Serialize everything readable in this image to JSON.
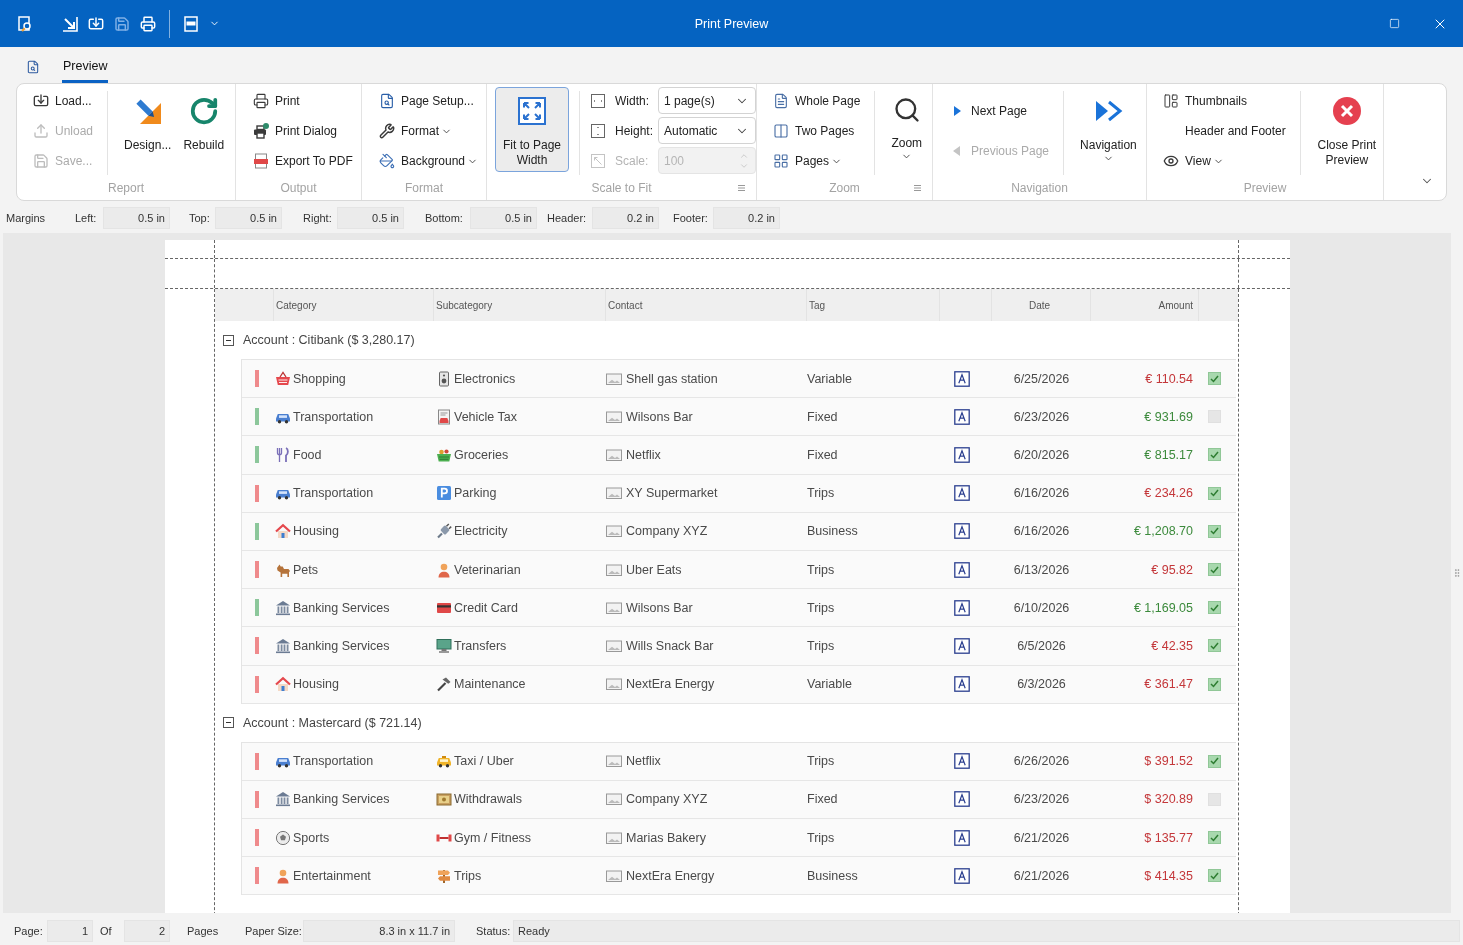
{
  "window": {
    "title": "Print Preview"
  },
  "quick_access": [
    {
      "disabled": false
    },
    {
      "disabled": false
    },
    {
      "disabled": true
    },
    {
      "disabled": false
    },
    {
      "disabled": false
    }
  ],
  "ribbon": {
    "tabs": [
      {
        "label": "Preview",
        "selected": true
      }
    ],
    "groups": [
      {
        "label": "Report",
        "columns": [
          {
            "kind": "stack",
            "items": [
              {
                "label": "Load...",
                "disabled": false
              },
              {
                "label": "Unload",
                "disabled": true
              },
              {
                "label": "Save...",
                "disabled": true
              }
            ]
          },
          {
            "kind": "large",
            "items": [
              {
                "label": "Design..."
              },
              {
                "label": "Rebuild"
              }
            ]
          }
        ]
      },
      {
        "label": "Output",
        "columns": [
          {
            "kind": "stack",
            "items": [
              {
                "label": "Print"
              },
              {
                "label": "Print Dialog"
              },
              {
                "label": "Export To PDF"
              }
            ]
          }
        ]
      },
      {
        "label": "Format",
        "columns": [
          {
            "kind": "stack",
            "items": [
              {
                "label": "Page Setup..."
              },
              {
                "label": "Format",
                "dropdown": true
              },
              {
                "label": "Background",
                "dropdown": true
              }
            ]
          }
        ]
      },
      {
        "label": "Scale to Fit",
        "launcher": true,
        "columns": [
          {
            "kind": "large",
            "items": [
              {
                "label": "Fit to Page Width",
                "selected": true
              }
            ]
          },
          {
            "kind": "fields",
            "items": [
              {
                "label": "Width:",
                "value": "1 page(s)",
                "kind": "dropdown",
                "disabled": false
              },
              {
                "label": "Height:",
                "value": "Automatic",
                "kind": "dropdown",
                "disabled": false
              },
              {
                "label": "Scale:",
                "value": "100",
                "kind": "spinner",
                "disabled": true
              }
            ]
          }
        ]
      },
      {
        "label": "Zoom",
        "launcher": true,
        "columns": [
          {
            "kind": "stack",
            "items": [
              {
                "label": "Whole Page"
              },
              {
                "label": "Two Pages"
              },
              {
                "label": "Pages",
                "dropdown": true
              }
            ]
          },
          {
            "kind": "large",
            "items": [
              {
                "label": "Zoom",
                "dropdown": true
              }
            ]
          }
        ]
      },
      {
        "label": "Navigation",
        "columns": [
          {
            "kind": "stack",
            "items": [
              {
                "label": "Next Page",
                "disabled": false
              },
              {
                "label": "Previous Page",
                "disabled": true
              }
            ]
          },
          {
            "kind": "large",
            "items": [
              {
                "label": "Navigation",
                "dropdown": true
              }
            ]
          }
        ]
      },
      {
        "label": "Preview",
        "columns": [
          {
            "kind": "stack",
            "items": [
              {
                "label": "Thumbnails"
              },
              {
                "label": "Header and Footer"
              },
              {
                "label": "View",
                "dropdown": true
              }
            ]
          },
          {
            "kind": "large",
            "items": [
              {
                "label": "Close Print Preview"
              }
            ]
          }
        ]
      }
    ]
  },
  "margins": {
    "label": "Margins",
    "fields": [
      {
        "label": "Left:",
        "value": "0.5 in"
      },
      {
        "label": "Top:",
        "value": "0.5 in"
      },
      {
        "label": "Right:",
        "value": "0.5 in"
      },
      {
        "label": "Bottom:",
        "value": "0.5 in"
      },
      {
        "label": "Header:",
        "value": "0.2 in"
      },
      {
        "label": "Footer:",
        "value": "0.2 in"
      }
    ]
  },
  "report": {
    "columns": [
      "Category",
      "Subcategory",
      "Contact",
      "Tag",
      "Date",
      "Amount"
    ],
    "groups": [
      {
        "title": "Account : Citibank ($ 3,280.17)",
        "expanded": true,
        "rows": [
          {
            "kind": "expense",
            "category": "Shopping",
            "subcategory": "Electronics",
            "contact": "Shell gas station",
            "tag": "Variable",
            "date": "6/25/2026",
            "amount": "€ 110.54",
            "checked": true
          },
          {
            "kind": "income",
            "category": "Transportation",
            "subcategory": "Vehicle Tax",
            "contact": "Wilsons Bar",
            "tag": "Fixed",
            "date": "6/23/2026",
            "amount": "€ 931.69",
            "checked": false
          },
          {
            "kind": "income",
            "category": "Food",
            "subcategory": "Groceries",
            "contact": "Netflix",
            "tag": "Fixed",
            "date": "6/20/2026",
            "amount": "€ 815.17",
            "checked": true
          },
          {
            "kind": "expense",
            "category": "Transportation",
            "subcategory": "Parking",
            "contact": "XY Supermarket",
            "tag": "Trips",
            "date": "6/16/2026",
            "amount": "€ 234.26",
            "checked": true
          },
          {
            "kind": "income",
            "category": "Housing",
            "subcategory": "Electricity",
            "contact": "Company XYZ",
            "tag": "Business",
            "date": "6/16/2026",
            "amount": "€ 1,208.70",
            "checked": true
          },
          {
            "kind": "expense",
            "category": "Pets",
            "subcategory": "Veterinarian",
            "contact": "Uber Eats",
            "tag": "Trips",
            "date": "6/13/2026",
            "amount": "€ 95.82",
            "checked": true
          },
          {
            "kind": "income",
            "category": "Banking Services",
            "subcategory": "Credit Card",
            "contact": "Wilsons Bar",
            "tag": "Trips",
            "date": "6/10/2026",
            "amount": "€ 1,169.05",
            "checked": true
          },
          {
            "kind": "expense",
            "category": "Banking Services",
            "subcategory": "Transfers",
            "contact": "Wills Snack Bar",
            "tag": "Trips",
            "date": "6/5/2026",
            "amount": "€ 42.35",
            "checked": true
          },
          {
            "kind": "expense",
            "category": "Housing",
            "subcategory": "Maintenance",
            "contact": "NextEra Energy",
            "tag": "Variable",
            "date": "6/3/2026",
            "amount": "€ 361.47",
            "checked": true
          }
        ]
      },
      {
        "title": "Account : Mastercard ($ 721.14)",
        "expanded": true,
        "rows": [
          {
            "kind": "expense",
            "category": "Transportation",
            "subcategory": "Taxi / Uber",
            "contact": "Netflix",
            "tag": "Trips",
            "date": "6/26/2026",
            "amount": "$ 391.52",
            "checked": true
          },
          {
            "kind": "expense",
            "category": "Banking Services",
            "subcategory": "Withdrawals",
            "contact": "Company XYZ",
            "tag": "Fixed",
            "date": "6/23/2026",
            "amount": "$ 320.89",
            "checked": false
          },
          {
            "kind": "expense",
            "category": "Sports",
            "subcategory": "Gym / Fitness",
            "contact": "Marias Bakery",
            "tag": "Trips",
            "date": "6/21/2026",
            "amount": "$ 135.77",
            "checked": true
          },
          {
            "kind": "expense",
            "category": "Entertainment",
            "subcategory": "Trips",
            "contact": "NextEra Energy",
            "tag": "Business",
            "date": "6/21/2026",
            "amount": "$ 414.35",
            "checked": true
          }
        ]
      }
    ]
  },
  "status_bar": {
    "fields": [
      {
        "label": "Page:",
        "value": "1"
      },
      {
        "label": "Of",
        "value": "2"
      },
      {
        "label": "Pages"
      },
      {
        "label": "Paper Size:",
        "value": "8.3 in x 11.7 in"
      },
      {
        "label": "Status:",
        "value": "Ready"
      }
    ]
  }
}
